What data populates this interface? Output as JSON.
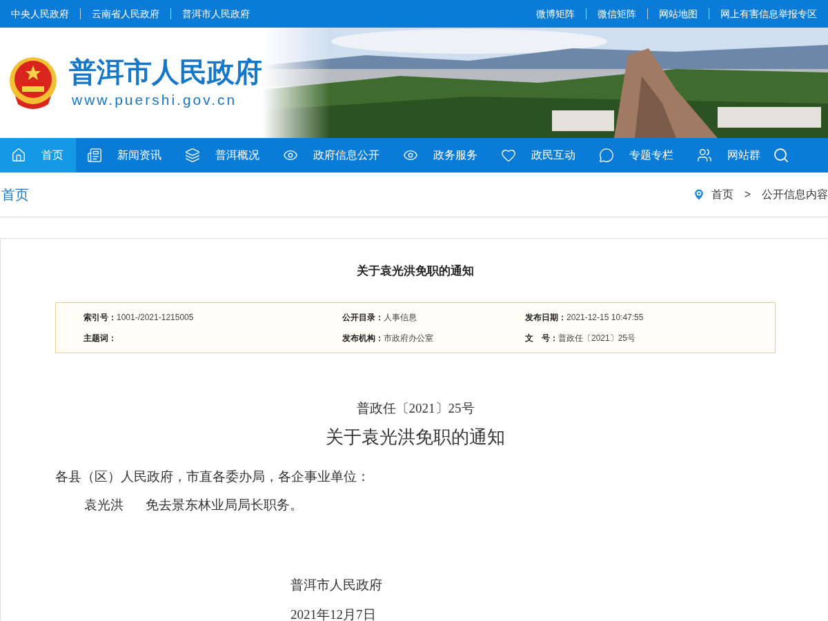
{
  "top_links_left": [
    "中央人民政府",
    "云南省人民政府",
    "普洱市人民政府"
  ],
  "top_links_right": [
    "微博矩阵",
    "微信矩阵",
    "网站地图",
    "网上有害信息举报专区"
  ],
  "header": {
    "site_name": "普洱市人民政府",
    "url": "www.puershi.gov.cn"
  },
  "nav": [
    {
      "label": "首页",
      "kind": "home",
      "selected": true
    },
    {
      "label": "新闻资讯",
      "kind": "news",
      "selected": false
    },
    {
      "label": "普洱概况",
      "kind": "layers",
      "selected": false
    },
    {
      "label": "政府信息公开",
      "kind": "eye",
      "selected": false
    },
    {
      "label": "政务服务",
      "kind": "eye",
      "selected": false
    },
    {
      "label": "政民互动",
      "kind": "heart",
      "selected": false
    },
    {
      "label": "专题专栏",
      "kind": "chat",
      "selected": false
    },
    {
      "label": "网站群",
      "kind": "users",
      "selected": false
    }
  ],
  "section_title": "首页",
  "breadcrumb": [
    "首页",
    "公开信息内容"
  ],
  "breadcrumb_separator": ">",
  "article": {
    "title": "关于袁光洪免职的通知",
    "meta": [
      [
        {
          "label": "索引号：",
          "value": "1001-/2021-1215005"
        },
        {
          "label": "公开目录：",
          "value": "人事信息"
        },
        {
          "label": "发布日期：",
          "value": "2021-12-15 10:47:55"
        }
      ],
      [
        {
          "label": "主题词："
        },
        {
          "label": "发布机构：",
          "value": "市政府办公室"
        },
        {
          "label": "文　号：",
          "value": "普政任〔2021〕25号"
        }
      ]
    ],
    "doc_number": "普政任〔2021〕25号",
    "doc_title": "关于袁光洪免职的通知",
    "salutation": "各县（区）人民政府，市直各委办局，各企事业单位：",
    "body": [
      {
        "name": "袁光洪",
        "text": "免去景东林业局局长职务。"
      }
    ],
    "signature": "普洱市人民政府",
    "date": "2021年12月7日"
  }
}
